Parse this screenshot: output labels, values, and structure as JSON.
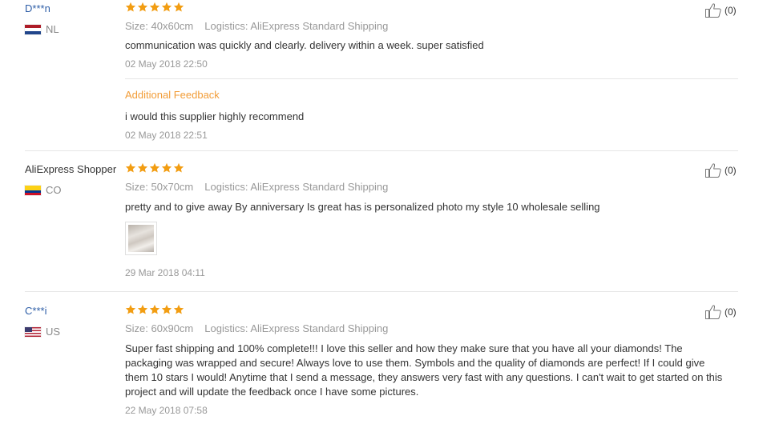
{
  "reviews": [
    {
      "user": "D***n",
      "country": "NL",
      "flag_colors": [
        "#ae1c28",
        "#ffffff",
        "#21468b"
      ],
      "rating": 5,
      "size": "Size: 40x60cm",
      "logistics": "Logistics: AliExpress Standard Shipping",
      "text": "communication was quickly and clearly. delivery within a week. super satisfied",
      "date": "02 May 2018 22:50",
      "additional_label": "Additional Feedback",
      "additional_text": "i would this supplier highly recommend",
      "additional_date": "02 May 2018 22:51",
      "likes": "(0)"
    },
    {
      "user": "AliExpress Shopper",
      "country": "CO",
      "flag_colors": [
        "#fcd116",
        "#003893",
        "#ce1126"
      ],
      "rating": 5,
      "size": "Size: 50x70cm",
      "logistics": "Logistics: AliExpress Standard Shipping",
      "text": "pretty and to give away By anniversary Is great has is personalized photo my style 10 wholesale selling",
      "date": "29 Mar 2018 04:11",
      "likes": "(0)"
    },
    {
      "user": "C***i",
      "country": "US",
      "flag_colors": [
        "#b22234",
        "#ffffff",
        "#3c3b6e"
      ],
      "rating": 5,
      "size": "Size: 60x90cm",
      "logistics": "Logistics: AliExpress Standard Shipping",
      "text": "Super fast shipping and 100% complete!!! I love this seller and how they make sure that you have all your diamonds! The packaging was wrapped and secure! Always love to use them. Symbols and the quality of diamonds are perfect! If I could give them 10 stars I would! Anytime that I send a message, they answers very fast with any questions. I can't wait to get started on this project and will update the feedback once I have some pictures.",
      "date": "22 May 2018 07:58",
      "likes": "(0)"
    }
  ],
  "colors": {
    "star": "#f29d12",
    "link": "#2e5ea7",
    "additional": "#f29d38",
    "muted": "#999999"
  },
  "icons": {
    "star": "star-icon",
    "like": "thumbs-up-icon"
  }
}
